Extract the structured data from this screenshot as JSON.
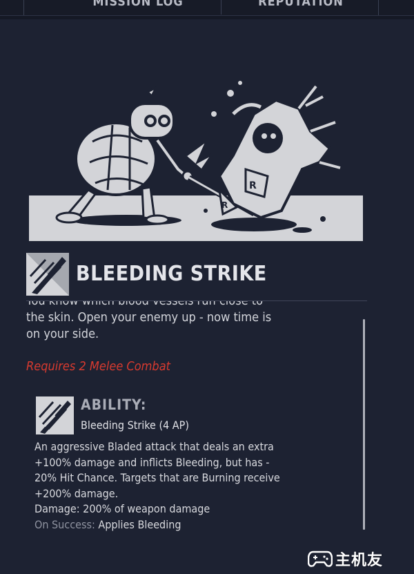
{
  "tabs": [
    "MISSION LOG",
    "REPUTATION"
  ],
  "skill": {
    "title": "BLEEDING STRIKE",
    "description_lines": [
      "You know which blood vessels run close to",
      "the skin. Open your enemy up - now time is",
      "on your side."
    ],
    "requirement": "Requires 2 Melee Combat"
  },
  "ability": {
    "label": "ABILITY:",
    "name": "Bleeding Strike (4 AP)",
    "text_lines": [
      "An aggressive Bladed attack that deals an extra",
      "+100% damage and inflicts Bleeding, but has -",
      "20% Hit Chance. Targets that are Burning receive",
      "+200% damage."
    ],
    "damage": "Damage: 200% of weapon damage",
    "on_success_label": "On Success:",
    "on_success_value": "Applies Bleeding"
  },
  "watermark": "主机友",
  "icons": {
    "skill_icon": "slash-blade-icon",
    "ability_icon": "slash-blade-icon",
    "watermark_icon": "gamepad-icon"
  },
  "colors": {
    "background": "#1d2232",
    "requirement": "#d83a2f",
    "illustration_fg": "#d3d4d8"
  }
}
